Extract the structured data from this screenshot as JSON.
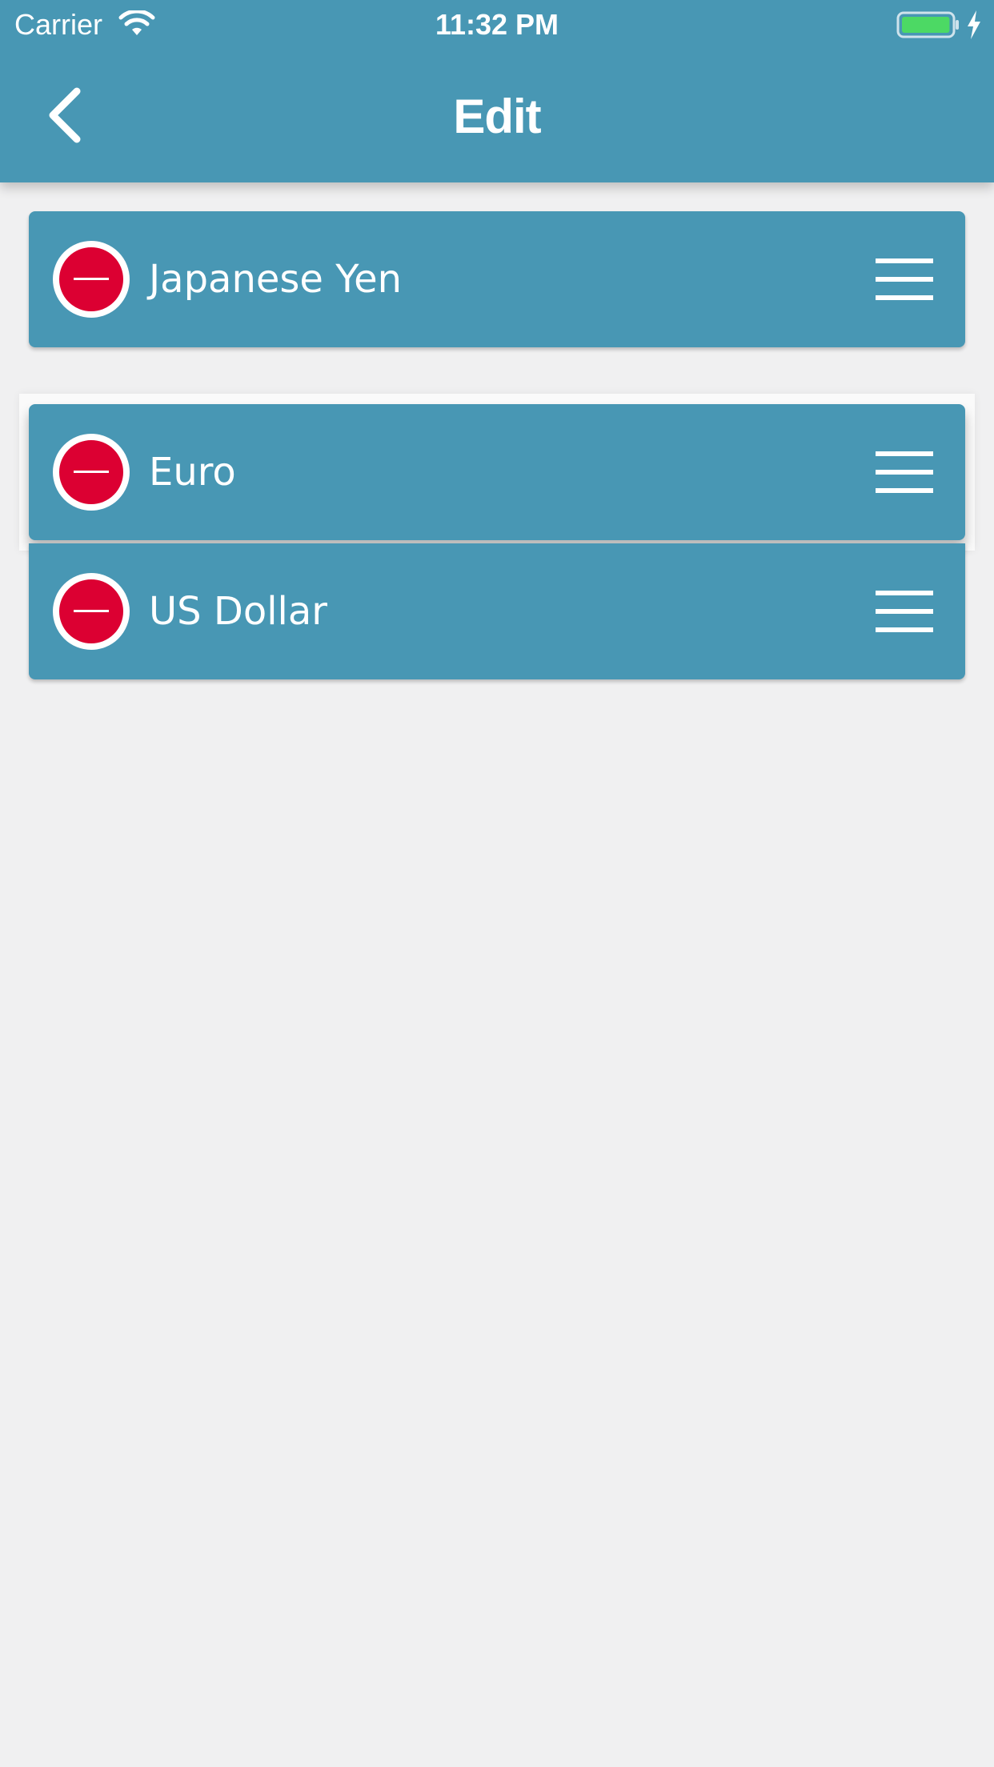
{
  "status_bar": {
    "carrier": "Carrier",
    "time": "11:32 PM",
    "wifi_icon": "wifi-icon",
    "battery_icon": "battery-icon",
    "battery_level": 0.9,
    "charging_icon": "bolt-icon"
  },
  "header": {
    "title": "Edit",
    "back_icon": "chevron-left-icon",
    "background_color": "#4897b4"
  },
  "list": {
    "items": [
      {
        "label": "Japanese Yen",
        "delete_icon": "minus-circle-icon",
        "handle_icon": "reorder-handle-icon"
      },
      {
        "label": "Euro",
        "delete_icon": "minus-circle-icon",
        "handle_icon": "reorder-handle-icon",
        "dragging": true
      },
      {
        "label": "US Dollar",
        "delete_icon": "minus-circle-icon",
        "handle_icon": "reorder-handle-icon"
      }
    ],
    "row_color": "#4897b4",
    "delete_color": "#dc0032"
  }
}
